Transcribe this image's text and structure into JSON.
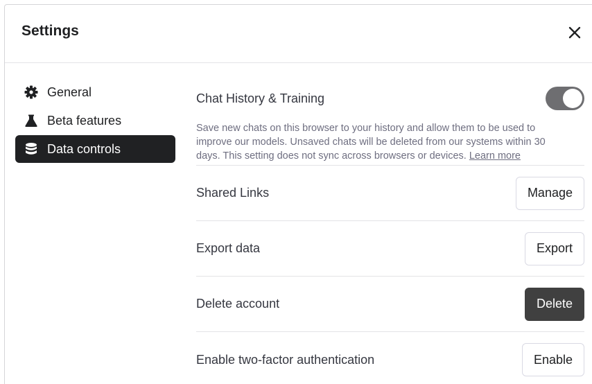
{
  "header": {
    "title": "Settings",
    "close_icon": "close-icon"
  },
  "sidebar": {
    "items": [
      {
        "label": "General",
        "icon": "gear-icon",
        "active": false
      },
      {
        "label": "Beta features",
        "icon": "flask-icon",
        "active": false
      },
      {
        "label": "Data controls",
        "icon": "database-icon",
        "active": true
      }
    ]
  },
  "chat_history": {
    "title": "Chat History & Training",
    "enabled": true,
    "description": "Save new chats on this browser to your history and allow them to be used to improve our models. Unsaved chats will be deleted from our systems within 30 days. This setting does not sync across browsers or devices.",
    "learn_more": "Learn more"
  },
  "rows": {
    "shared_links": {
      "label": "Shared Links",
      "button": "Manage"
    },
    "export": {
      "label": "Export data",
      "button": "Export"
    },
    "delete": {
      "label": "Delete account",
      "button": "Delete"
    },
    "two_factor": {
      "label": "Enable two-factor authentication",
      "button": "Enable"
    }
  },
  "colors": {
    "active_bg": "#202123",
    "toggle_on": "#6e6e71",
    "danger_btn": "#404040"
  }
}
